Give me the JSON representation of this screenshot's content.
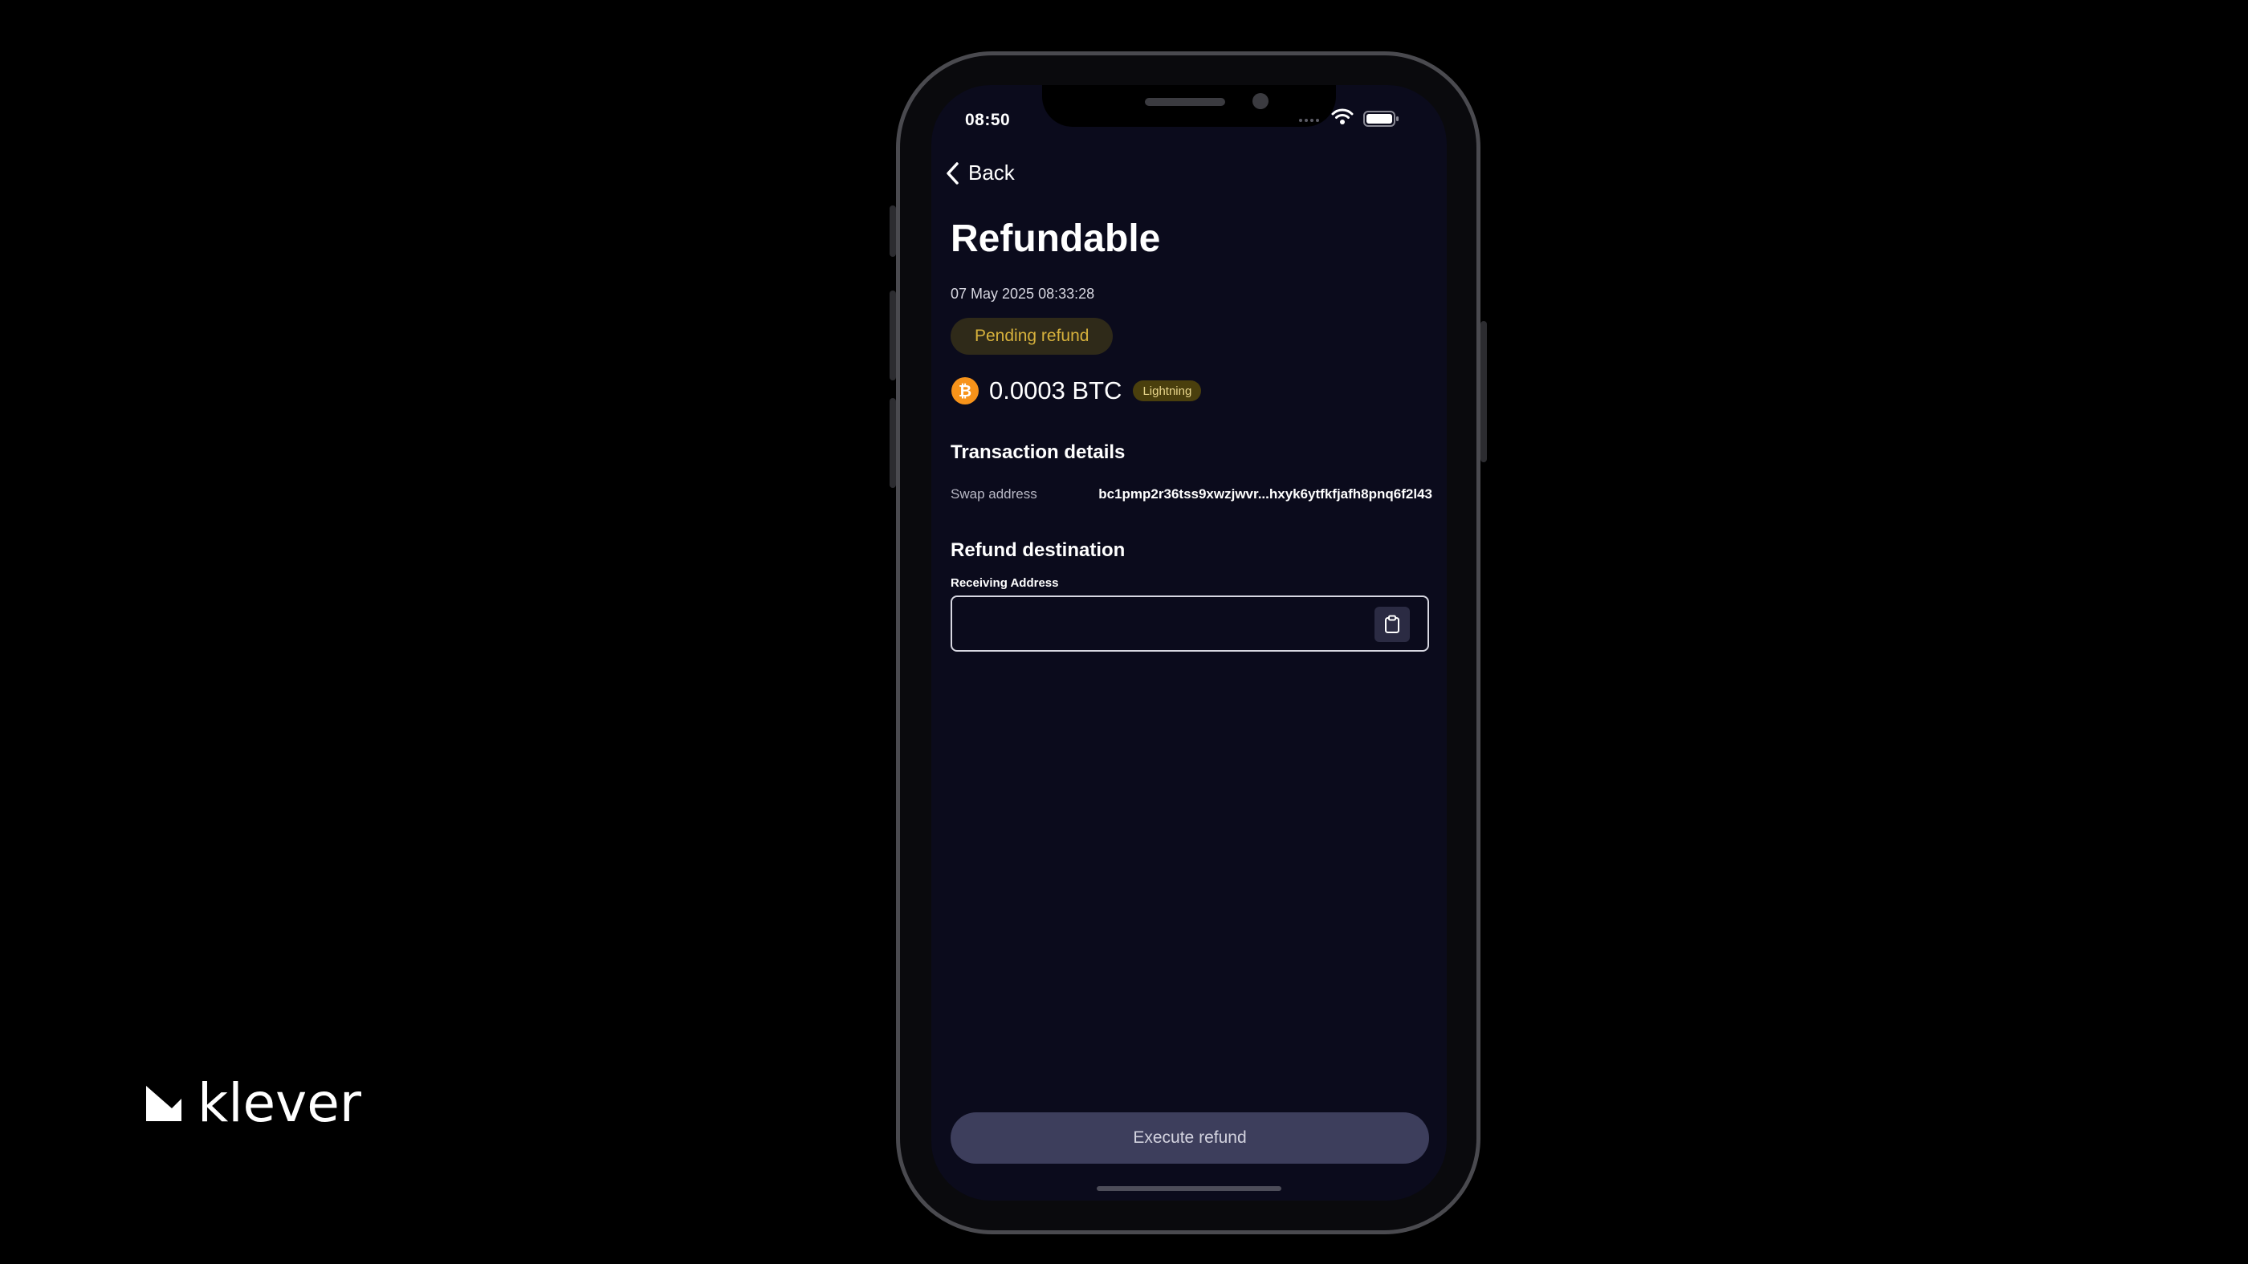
{
  "brand": {
    "name": "klever",
    "icon": "klever-logo-icon"
  },
  "status_bar": {
    "time": "08:50",
    "icons": [
      "signal-dots-icon",
      "wifi-icon",
      "battery-icon"
    ]
  },
  "nav": {
    "back_label": "Back",
    "back_icon": "chevron-left-icon"
  },
  "header": {
    "title": "Refundable",
    "date": "07 May 2025 08:33:28",
    "status": "Pending refund"
  },
  "amount": {
    "value": "0.0003 BTC",
    "asset_icon": "bitcoin-icon",
    "network": "Lightning"
  },
  "transaction_details": {
    "title": "Transaction details",
    "rows": [
      {
        "label": "Swap address",
        "value": "bc1pmp2r36tss9xwzjwvr...hxyk6ytfkfjafh8pnq6f2l43"
      }
    ]
  },
  "refund_destination": {
    "title": "Refund destination",
    "field_label": "Receiving Address",
    "field_value": "",
    "field_placeholder": "",
    "paste_icon": "clipboard-icon"
  },
  "actions": {
    "primary_label": "Execute refund"
  },
  "colors": {
    "background": "#000000",
    "screen": "#0b0b1c",
    "pending_text": "#d6b13c",
    "pending_bg": "#2f2a19",
    "network_bg": "#4a3f0d",
    "bitcoin": "#f7931a",
    "button_bg": "#3d3e5c"
  }
}
